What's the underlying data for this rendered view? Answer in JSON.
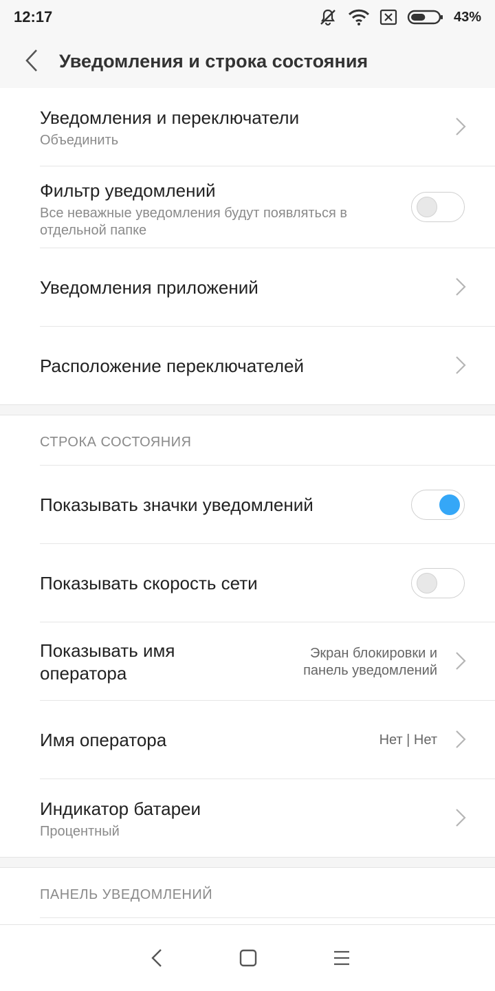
{
  "status_bar": {
    "time": "12:17",
    "battery_percent": "43%",
    "battery_level": 0.43,
    "icons": [
      "vibrate-off-icon",
      "wifi-icon",
      "sim-x-icon",
      "battery-icon"
    ]
  },
  "header": {
    "title": "Уведомления и строка состояния"
  },
  "sections": [
    {
      "items": [
        {
          "title": "Уведомления и переключатели",
          "subtitle": "Объединить",
          "control": "chevron"
        },
        {
          "title": "Фильтр уведомлений",
          "subtitle_line1": "Все неважные уведомления будут появляться в",
          "subtitle_line2": "отдельной папке",
          "control": "toggle",
          "enabled": false
        },
        {
          "title": "Уведомления приложений",
          "control": "chevron"
        },
        {
          "title": "Расположение переключателей",
          "control": "chevron"
        }
      ]
    },
    {
      "header": "СТРОКА СОСТОЯНИЯ",
      "items": [
        {
          "title": "Показывать значки уведомлений",
          "control": "toggle",
          "enabled": true
        },
        {
          "title": "Показывать скорость сети",
          "control": "toggle",
          "enabled": false
        },
        {
          "title_line1": "Показывать имя",
          "title_line2": "оператора",
          "value_line1": "Экран блокировки и",
          "value_line2": "панель уведомлений",
          "control": "chevron"
        },
        {
          "title": "Имя оператора",
          "value": "Нет | Нет",
          "control": "chevron"
        },
        {
          "title": "Индикатор батареи",
          "subtitle": "Процентный",
          "control": "chevron"
        }
      ]
    },
    {
      "header": "ПАНЕЛЬ УВЕДОМЛЕНИЙ"
    }
  ],
  "nav_bar": {
    "buttons": [
      "back-icon",
      "home-icon",
      "menu-icon"
    ]
  },
  "colors": {
    "accent": "#35a7f7",
    "background": "#f5f5f5",
    "text_primary": "#222222",
    "text_secondary": "#8a8a8a"
  }
}
